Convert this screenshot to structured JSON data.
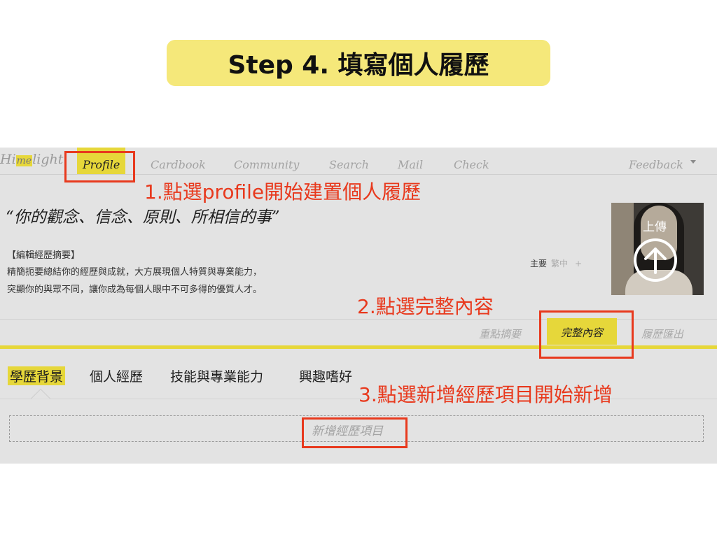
{
  "slide": {
    "title": "Step 4. 填寫個人履歷"
  },
  "navbar": {
    "logo": {
      "prefix": "Hi",
      "me": "me",
      "suffix": "light"
    },
    "items": [
      "Profile",
      "Cardbook",
      "Community",
      "Search",
      "Mail",
      "Check"
    ],
    "right_item": "Feedback",
    "active": "Profile"
  },
  "profile": {
    "quote": "“你的觀念、信念、原則、所相信的事”",
    "summary_label": "【編輯經歷摘要】",
    "summary_lines": [
      "精簡扼要總結你的經歷與成就，大方展現個人特質與專業能力，",
      "突顯你的與眾不同，讓你成為每個人眼中不可多得的優質人才。"
    ],
    "language": {
      "primary": "主要",
      "secondary": "繁中",
      "add": "+"
    },
    "upload_label": "上傳"
  },
  "subtabs": [
    "重點摘要",
    "完整內容",
    "履歷匯出"
  ],
  "section_tabs": [
    "學歷背景",
    "個人經歷",
    "技能與專業能力",
    "興趣嗜好"
  ],
  "add_item": "新增經歷項目",
  "annotations": {
    "step1": "1.點選profile開始建置個人履歷",
    "step2": "2.點選完整內容",
    "step3": "3.點選新增經歷項目開始新增"
  },
  "colors": {
    "accent_yellow": "#e6d73a",
    "title_pill": "#f5e87a",
    "annotation_red": "#e8391d"
  },
  "icons": [
    "upload-arrow-icon",
    "caret-down-icon"
  ]
}
